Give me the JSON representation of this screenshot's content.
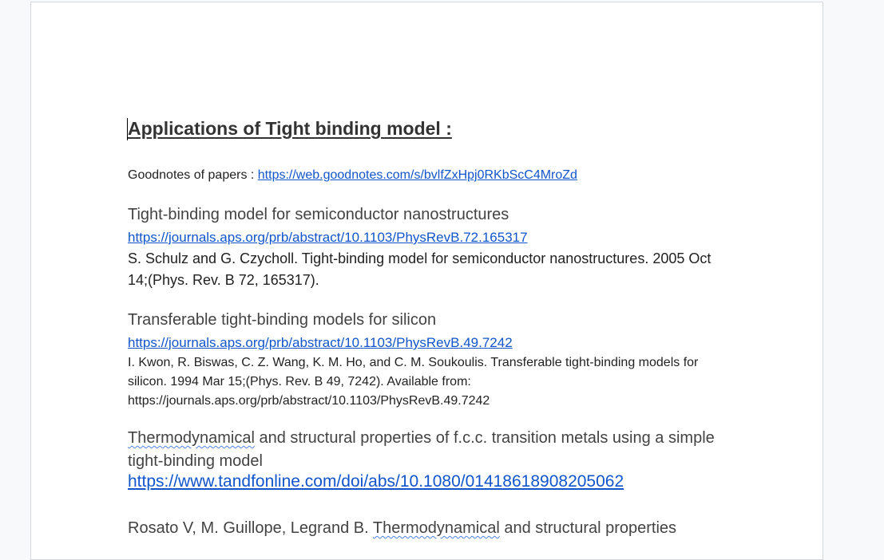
{
  "doc": {
    "title": "Applications of Tight binding model :",
    "goodnotes": {
      "label": "Goodnotes of papers : ",
      "url": "https://web.goodnotes.com/s/bvlfZxHpj0RKbScC4MroZd"
    },
    "entries": [
      {
        "heading": "Tight-binding model for semiconductor nanostructures",
        "url": "https://journals.aps.org/prb/abstract/10.1103/PhysRevB.72.165317",
        "citation": "S. Schulz and G. Czycholl. Tight-binding model for semiconductor nanostructures. 2005 Oct 14;(Phys. Rev. B 72, 165317)."
      },
      {
        "heading": "Transferable tight-binding models for silicon",
        "url": "https://journals.aps.org/prb/abstract/10.1103/PhysRevB.49.7242",
        "citation": "I. Kwon, R. Biswas, C. Z. Wang, K. M. Ho, and C. M. Soukoulis. Transferable tight-binding models for silicon. 1994 Mar 15;(Phys. Rev. B 49, 7242). Available from: https://journals.aps.org/prb/abstract/10.1103/PhysRevB.49.7242"
      },
      {
        "heading_word": "Thermodynamical",
        "heading_rest": " and structural properties of f.c.c. transition metals using a simple tight-binding model",
        "url": "https://www.tandfonline.com/doi/abs/10.1080/01418618908205062",
        "citation_start": "Rosato V, M. Guillope, Legrand B. ",
        "citation_word": "Thermodynamical",
        "citation_rest": " and structural properties"
      }
    ]
  }
}
